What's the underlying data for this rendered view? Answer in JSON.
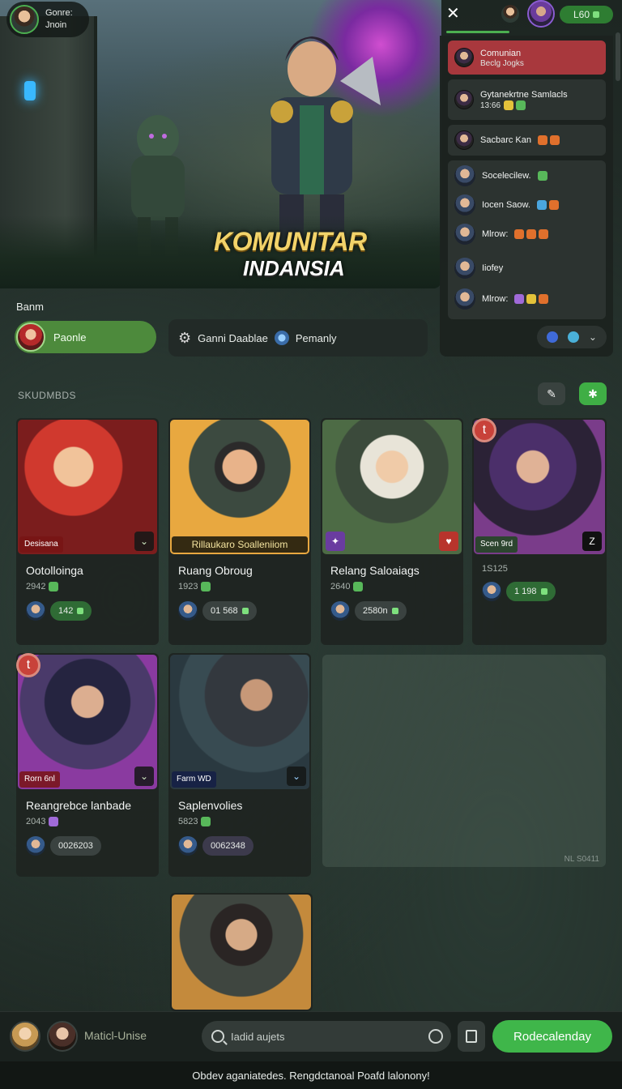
{
  "profile": {
    "line1": "Gonre:",
    "line2": "Jnoin"
  },
  "hero": {
    "title1": "KOMUNITAR",
    "title2": "INDANSIA"
  },
  "topbar": {
    "coins": "L60"
  },
  "panel": {
    "items": [
      {
        "title": "Comunian",
        "sub": "Beclg Jogks"
      },
      {
        "title": "Gytanekrtne Samlacls",
        "sub": "13:66"
      },
      {
        "title": "Sacbarc Kan"
      }
    ],
    "group": [
      {
        "label": "Socelecilew."
      },
      {
        "label": "Iocen Saow."
      },
      {
        "label": "Mlrow:"
      },
      {
        "label": "Iiofey"
      },
      {
        "label": "Mlrow:"
      }
    ]
  },
  "section": {
    "title": "Banm",
    "filter_active": "Paonle",
    "filter_bar_a": "Ganni Daablae",
    "filter_bar_b": "Pemanly"
  },
  "list": {
    "label": "SKUDMBDS"
  },
  "cards": [
    {
      "tag": "Desisana",
      "name": "Ootolloinga",
      "meta": "2942",
      "pill": "142"
    },
    {
      "tag": "Rillaukaro Soalleniiom",
      "name": "Ruang Obroug",
      "meta": "1923",
      "pill": "01 568"
    },
    {
      "name": "Relang Saloaiags",
      "meta": "2640",
      "pill": "2580n"
    },
    {
      "tag": "Scen 9rd",
      "meta": "1S125",
      "pill": "1 198"
    },
    {
      "tag": "Rorn 6nl",
      "name": "Reangrebce lanbade",
      "meta": "2043",
      "pill": "0026203"
    },
    {
      "tag": "Farm WD",
      "name": "Saplenvolies",
      "meta": "5823",
      "pill": "0062348"
    }
  ],
  "ghost": {
    "label": "NL S0411"
  },
  "bottom": {
    "label": "Maticl-Unise",
    "search_placeholder": "Iadid aujets",
    "cta": "Rodecalenday"
  },
  "footer": {
    "text": "Obdev aganiatedes. Rengdctanoal Poafd lalonony!"
  },
  "colors": {
    "accent": "#3fb64a",
    "alert": "#a8383d",
    "bg": "#1f2924"
  }
}
